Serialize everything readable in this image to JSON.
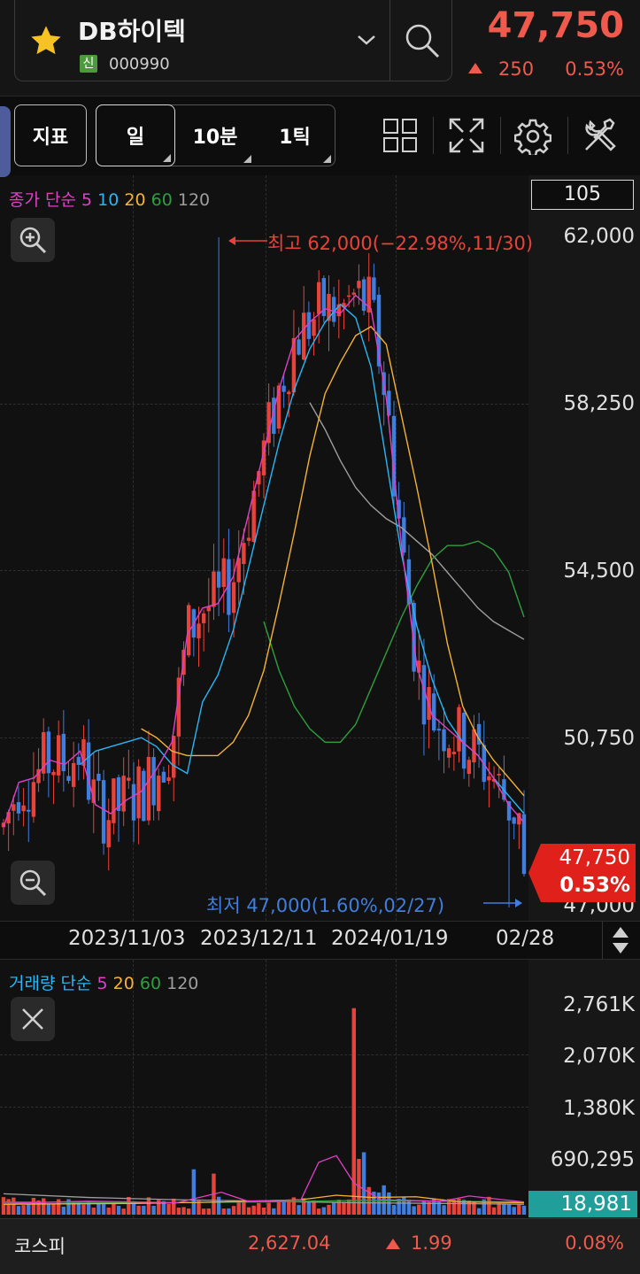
{
  "header": {
    "stock_name": "DB하이텍",
    "credit_badge": "신",
    "stock_code": "000990",
    "price": "47,750",
    "change": "250",
    "change_rate": "0.53%",
    "icons": [
      "star-icon",
      "chevron-down-icon",
      "search-icon"
    ]
  },
  "toolbar": {
    "indicator_label": "지표",
    "period_day": "일",
    "period_10min": "10분",
    "period_tick": "1틱",
    "icons": [
      "grid-layout-icon",
      "fullscreen-icon",
      "gear-icon",
      "tools-icon"
    ]
  },
  "price_chart": {
    "legend_title": "종가 단순",
    "ma_labels": [
      "5",
      "10",
      "20",
      "60",
      "120"
    ],
    "visible_count": "105",
    "axis_labels": [
      "62,000",
      "58,250",
      "54,500",
      "50,750",
      "47,000"
    ],
    "high_annotation": "최고 62,000(−22.98%,11/30)",
    "low_annotation": "최저 47,000(1.60%,02/27)",
    "current_price_tag": "47,750",
    "current_rate_tag": "0.53%",
    "icons": [
      "zoom-in-icon",
      "zoom-out-icon"
    ]
  },
  "date_axis": {
    "labels": [
      "2023/11/03",
      "2023/12/11",
      "2024/01/19",
      "02/28"
    ],
    "icons": [
      "sort-arrows-icon"
    ]
  },
  "volume_chart": {
    "legend_title": "거래량 단순",
    "ma_labels": [
      "5",
      "20",
      "60",
      "120"
    ],
    "axis_labels": [
      "2,761K",
      "2,070K",
      "1,380K",
      "690,295"
    ],
    "current_volume_tag": "18,981",
    "icons": [
      "close-icon"
    ]
  },
  "footer": {
    "index_name": "코스피",
    "index_value": "2,627.04",
    "index_change": "1.99",
    "index_rate": "0.08%"
  },
  "colors": {
    "up": "#e8433a",
    "down": "#3f7ddf",
    "ma5": "#e040c8",
    "ma10": "#29b6f6",
    "ma20": "#f5b335",
    "ma60": "#2e9e3e",
    "ma120": "#9e9e9e"
  },
  "chart_data": {
    "type": "candlestick",
    "y_range": [
      47000,
      62000
    ],
    "high": 62000,
    "low": 47000,
    "last_close": 47750,
    "ma5": [
      48800,
      49800,
      49900,
      50300,
      50200,
      50500,
      49300,
      49100,
      49400,
      49600,
      50100,
      50700,
      53100,
      53700,
      53800,
      54400,
      55800,
      57200,
      58600,
      59700,
      60100,
      60400,
      60300,
      60700,
      60400,
      58400,
      55100,
      52400,
      51300,
      51000,
      50700,
      50400,
      49900,
      49300,
      48900
    ],
    "ma10": [
      50200,
      50500,
      50600,
      50700,
      50800,
      50600,
      50200,
      50000,
      51600,
      52200,
      53200,
      54600,
      56000,
      57400,
      58600,
      59500,
      60100,
      60500,
      60200,
      59100,
      57000,
      54900,
      53300,
      52100,
      51200,
      50700,
      50400,
      49900,
      49500,
      49100
    ],
    "ma20": [
      51000,
      50800,
      50500,
      50400,
      50400,
      50400,
      50700,
      51300,
      52300,
      53800,
      55400,
      57100,
      58500,
      59200,
      59800,
      60000,
      59600,
      58000,
      56400,
      54700,
      52900,
      51500,
      50800,
      50300,
      49900,
      49500
    ],
    "ma60": [
      53400,
      52300,
      51500,
      51000,
      50700,
      50700,
      51100,
      51900,
      52700,
      53500,
      54200,
      54800,
      55100,
      55100,
      55200,
      55000,
      54500,
      53500
    ],
    "ma120": [
      58300,
      57700,
      57000,
      56400,
      56000,
      55700,
      55500,
      55200,
      54900,
      54500,
      54100,
      53700,
      53400,
      53200,
      53000
    ]
  }
}
